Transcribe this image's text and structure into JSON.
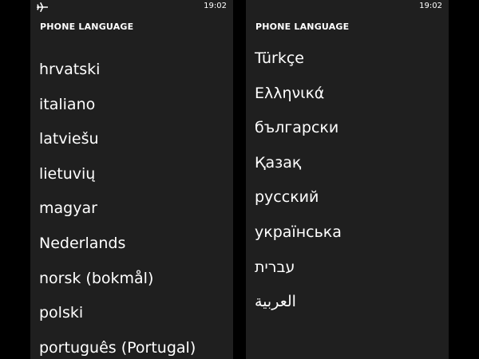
{
  "left_phone": {
    "status": {
      "time": "19:02",
      "airplane_icon": "airplane-icon"
    },
    "title": "PHONE LANGUAGE",
    "languages": [
      "hrvatski",
      "italiano",
      "latviešu",
      "lietuvių",
      "magyar",
      "Nederlands",
      "norsk (bokmål)",
      "polski",
      "português (Portugal)"
    ]
  },
  "right_phone": {
    "status": {
      "time": "19:02"
    },
    "title": "PHONE LANGUAGE",
    "languages": [
      "Türkçe",
      "Ελληνικά",
      "български",
      "Қазақ",
      "русский",
      "українська",
      "עברית",
      "العربية"
    ]
  },
  "colors": {
    "screen_background": "#1f1f1f",
    "outer_background": "#000000",
    "text": "#ffffff"
  }
}
